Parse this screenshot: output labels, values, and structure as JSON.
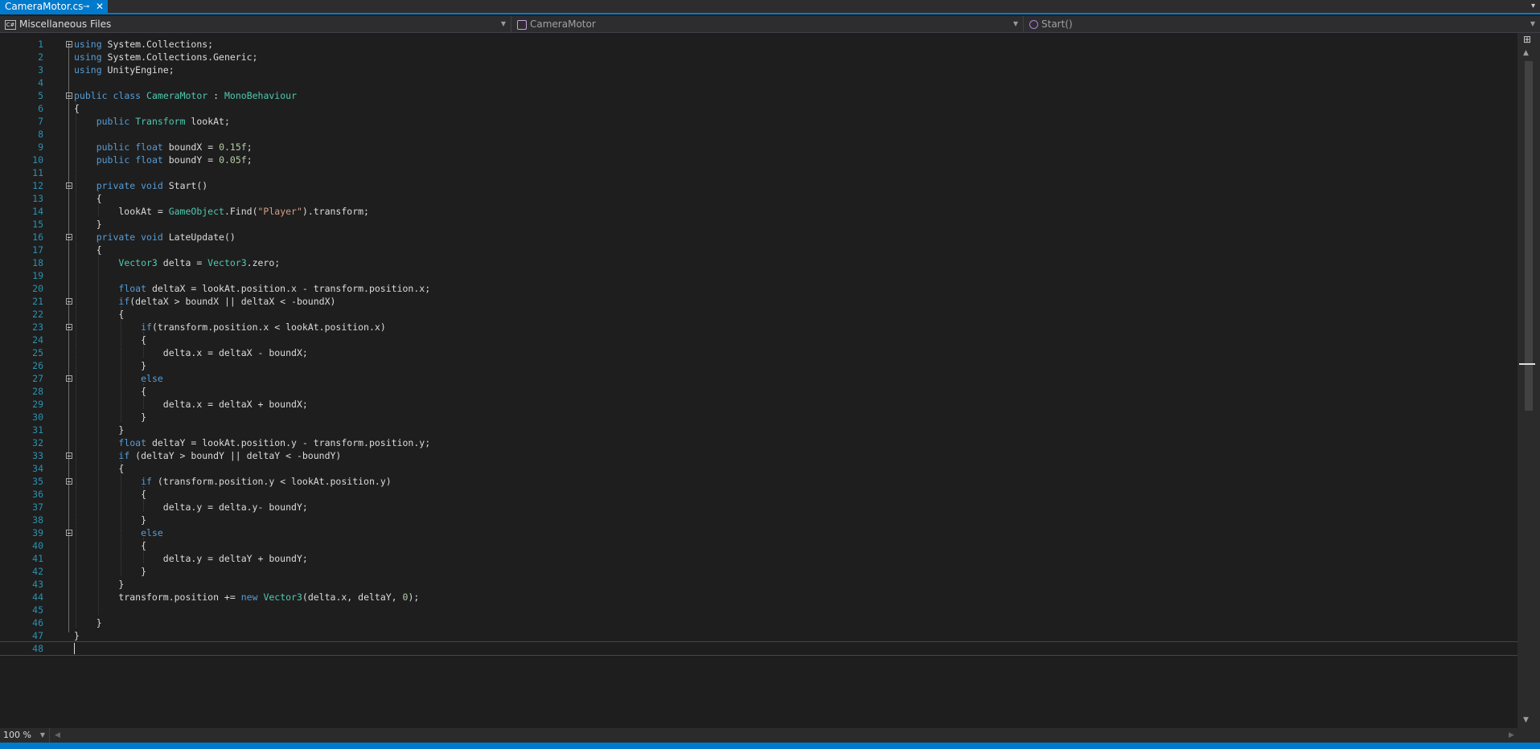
{
  "tab": {
    "title": "CameraMotor.cs",
    "pin_icon": "pin-icon",
    "close_icon": "close-icon"
  },
  "navbar": {
    "project": "Miscellaneous Files",
    "type": "CameraMotor",
    "member": "Start()"
  },
  "editor": {
    "current_line": 48,
    "lines": [
      {
        "n": "1",
        "fold": true,
        "t": "<span class='kw'>using</span> System.Collections;"
      },
      {
        "n": "2",
        "fold": false,
        "t": "<span class='kw'>using</span> System.Collections.Generic;"
      },
      {
        "n": "3",
        "fold": false,
        "t": "<span class='kw'>using</span> UnityEngine;"
      },
      {
        "n": "4",
        "fold": false,
        "t": ""
      },
      {
        "n": "5",
        "fold": true,
        "t": "<span class='kw'>public</span> <span class='kw'>class</span> <span class='ty'>CameraMotor</span> : <span class='ty'>MonoBehaviour</span>"
      },
      {
        "n": "6",
        "fold": false,
        "t": "{"
      },
      {
        "n": "7",
        "fold": false,
        "t": "    <span class='kw'>public</span> <span class='ty'>Transform</span> lookAt;"
      },
      {
        "n": "8",
        "fold": false,
        "t": ""
      },
      {
        "n": "9",
        "fold": false,
        "t": "    <span class='kw'>public</span> <span class='kw'>float</span> boundX = <span class='num'>0.15f</span>;"
      },
      {
        "n": "10",
        "fold": false,
        "t": "    <span class='kw'>public</span> <span class='kw'>float</span> boundY = <span class='num'>0.05f</span>;"
      },
      {
        "n": "11",
        "fold": false,
        "t": ""
      },
      {
        "n": "12",
        "fold": true,
        "t": "    <span class='kw'>private</span> <span class='kw'>void</span> Start()"
      },
      {
        "n": "13",
        "fold": false,
        "t": "    {"
      },
      {
        "n": "14",
        "fold": false,
        "t": "        lookAt = <span class='ty'>GameObject</span>.Find(<span class='str'>\"Player\"</span>).transform;"
      },
      {
        "n": "15",
        "fold": false,
        "t": "    }"
      },
      {
        "n": "16",
        "fold": true,
        "t": "    <span class='kw'>private</span> <span class='kw'>void</span> LateUpdate()"
      },
      {
        "n": "17",
        "fold": false,
        "t": "    {"
      },
      {
        "n": "18",
        "fold": false,
        "t": "        <span class='ty'>Vector3</span> delta = <span class='ty'>Vector3</span>.zero;"
      },
      {
        "n": "19",
        "fold": false,
        "t": ""
      },
      {
        "n": "20",
        "fold": false,
        "t": "        <span class='kw'>float</span> deltaX = lookAt.position.x - transform.position.x;"
      },
      {
        "n": "21",
        "fold": true,
        "t": "        <span class='kw'>if</span>(deltaX &gt; boundX || deltaX &lt; -boundX)"
      },
      {
        "n": "22",
        "fold": false,
        "t": "        {"
      },
      {
        "n": "23",
        "fold": true,
        "t": "            <span class='kw'>if</span>(transform.position.x &lt; lookAt.position.x)"
      },
      {
        "n": "24",
        "fold": false,
        "t": "            {"
      },
      {
        "n": "25",
        "fold": false,
        "t": "                delta.x = deltaX - boundX;"
      },
      {
        "n": "26",
        "fold": false,
        "t": "            }"
      },
      {
        "n": "27",
        "fold": true,
        "t": "            <span class='kw'>else</span>"
      },
      {
        "n": "28",
        "fold": false,
        "t": "            {"
      },
      {
        "n": "29",
        "fold": false,
        "t": "                delta.x = deltaX + boundX;"
      },
      {
        "n": "30",
        "fold": false,
        "t": "            }"
      },
      {
        "n": "31",
        "fold": false,
        "t": "        }"
      },
      {
        "n": "32",
        "fold": false,
        "t": "        <span class='kw'>float</span> deltaY = lookAt.position.y - transform.position.y;"
      },
      {
        "n": "33",
        "fold": true,
        "t": "        <span class='kw'>if</span> (deltaY &gt; boundY || deltaY &lt; -boundY)"
      },
      {
        "n": "34",
        "fold": false,
        "t": "        {"
      },
      {
        "n": "35",
        "fold": true,
        "t": "            <span class='kw'>if</span> (transform.position.y &lt; lookAt.position.y)"
      },
      {
        "n": "36",
        "fold": false,
        "t": "            {"
      },
      {
        "n": "37",
        "fold": false,
        "t": "                delta.y = delta.y- boundY;"
      },
      {
        "n": "38",
        "fold": false,
        "t": "            }"
      },
      {
        "n": "39",
        "fold": true,
        "t": "            <span class='kw'>else</span>"
      },
      {
        "n": "40",
        "fold": false,
        "t": "            {"
      },
      {
        "n": "41",
        "fold": false,
        "t": "                delta.y = deltaY + boundY;"
      },
      {
        "n": "42",
        "fold": false,
        "t": "            }"
      },
      {
        "n": "43",
        "fold": false,
        "t": "        }"
      },
      {
        "n": "44",
        "fold": false,
        "t": "        transform.position += <span class='kw'>new</span> <span class='ty'>Vector3</span>(delta.x, deltaY, <span class='num'>0</span>);"
      },
      {
        "n": "45",
        "fold": false,
        "t": ""
      },
      {
        "n": "46",
        "fold": false,
        "t": "    }"
      },
      {
        "n": "47",
        "fold": false,
        "t": "}"
      },
      {
        "n": "48",
        "fold": false,
        "t": ""
      }
    ]
  },
  "zoom": {
    "level": "100 %"
  },
  "colors": {
    "accent": "#007acc",
    "keyword": "#569cd6",
    "type": "#4ec9b0",
    "string": "#d69d85",
    "number": "#b5cea8",
    "line_number": "#2b91af"
  }
}
